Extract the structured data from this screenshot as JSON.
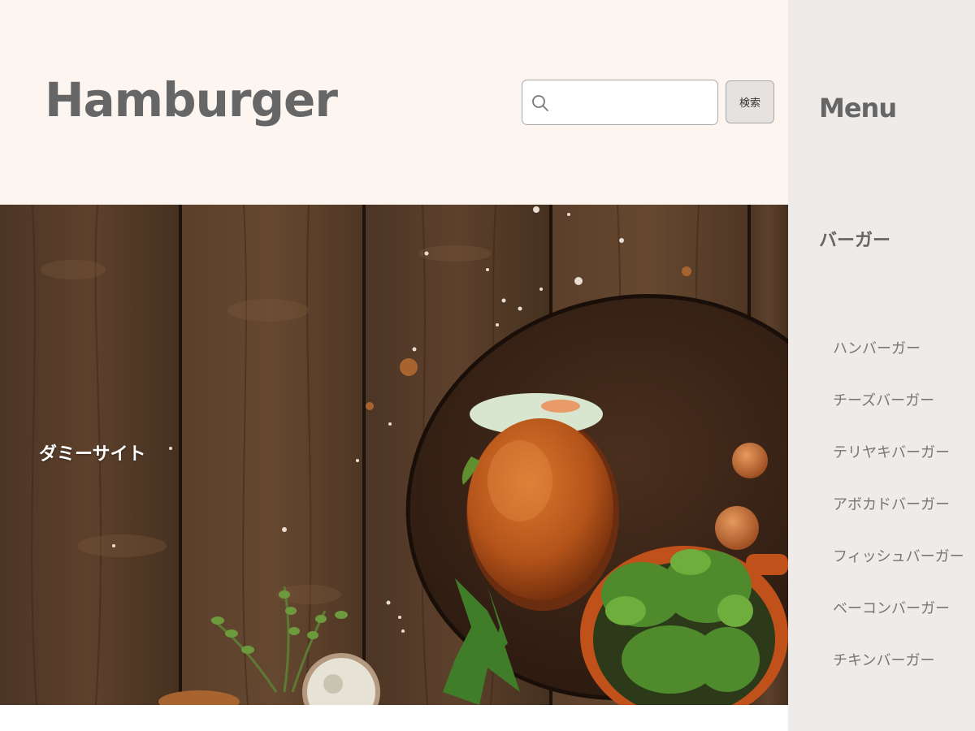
{
  "header": {
    "site_title": "Hamburger",
    "search": {
      "placeholder": "",
      "value": "",
      "button_label": "検索",
      "icon": "search-icon"
    }
  },
  "hero": {
    "caption": "ダミーサイト"
  },
  "sidebar": {
    "title": "Menu",
    "category": "バーガー",
    "items": [
      {
        "label": "ハンバーガー"
      },
      {
        "label": "チーズバーガー"
      },
      {
        "label": "テリヤキバーガー"
      },
      {
        "label": "アボカドバーガー"
      },
      {
        "label": "フィッシュバーガー"
      },
      {
        "label": "ベーコンバーガー"
      },
      {
        "label": "チキンバーガー"
      }
    ]
  },
  "colors": {
    "header_bg": "#fdf5f0",
    "sidebar_bg": "#efebe8",
    "title_text": "#666666",
    "menu_item_text": "#777777",
    "button_bg": "#e6e2df"
  }
}
